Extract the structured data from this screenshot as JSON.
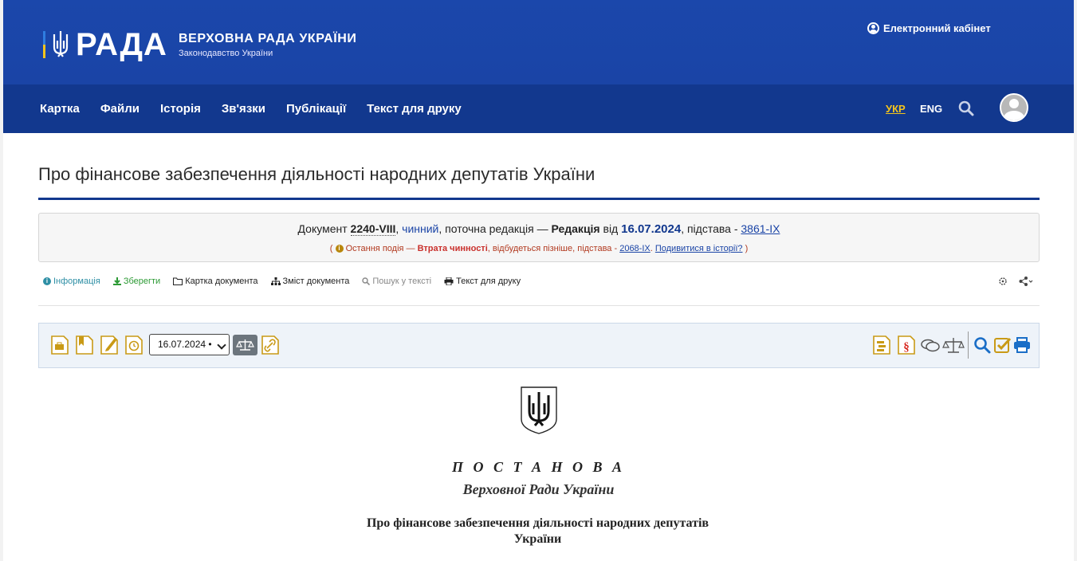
{
  "header": {
    "logo_text": "РАДА",
    "org_title": "ВЕРХОВНА РАДА УКРАЇНИ",
    "org_subtitle": "Законодавство України",
    "cabinet_label": "Електронний кабінет"
  },
  "nav": {
    "items": [
      "Картка",
      "Файли",
      "Історія",
      "Зв'язки",
      "Публікації",
      "Текст для друку"
    ],
    "lang_ukr": "УКР",
    "lang_eng": "ENG"
  },
  "page": {
    "title": "Про фінансове забезпечення діяльності народних депутатів України"
  },
  "info": {
    "doc_prefix": "Документ",
    "doc_number": "2240-VIII",
    "sep1": ",",
    "status": "чинний",
    "current_text": ", поточна редакція —",
    "edition_label": "Редакція",
    "from_text": "від",
    "edition_date": "16.07.2024",
    "basis_text": ", підстава -",
    "basis_link": "3861-IX",
    "event_open": "(",
    "event_text": "Остання подія —",
    "event_bold": "Втрата чинності",
    "event_rest": ", відбудеться пізніше, підстава -",
    "event_link": "2068-IX",
    "event_dot": ".",
    "history_link": "Подивитися в історії?",
    "event_close": ")"
  },
  "tools": {
    "info": "Інформація",
    "save": "Зберегти",
    "card": "Картка документа",
    "contents": "Зміст документа",
    "search": "Пошук у тексті",
    "print": "Текст для друку"
  },
  "toolbar": {
    "date_select": "16.07.2024 •"
  },
  "document": {
    "heading": "П О С Т А Н О В А",
    "subheading": "Верховної Ради України",
    "title_line1": "Про фінансове забезпечення діяльності народних депутатів",
    "title_line2": "України"
  },
  "colors": {
    "header_bg": "#1b47ab",
    "nav_bg": "#12388e",
    "accent_yellow": "#f4c41c",
    "link_blue": "#1a44a6",
    "icon_gold": "#c99a16"
  }
}
